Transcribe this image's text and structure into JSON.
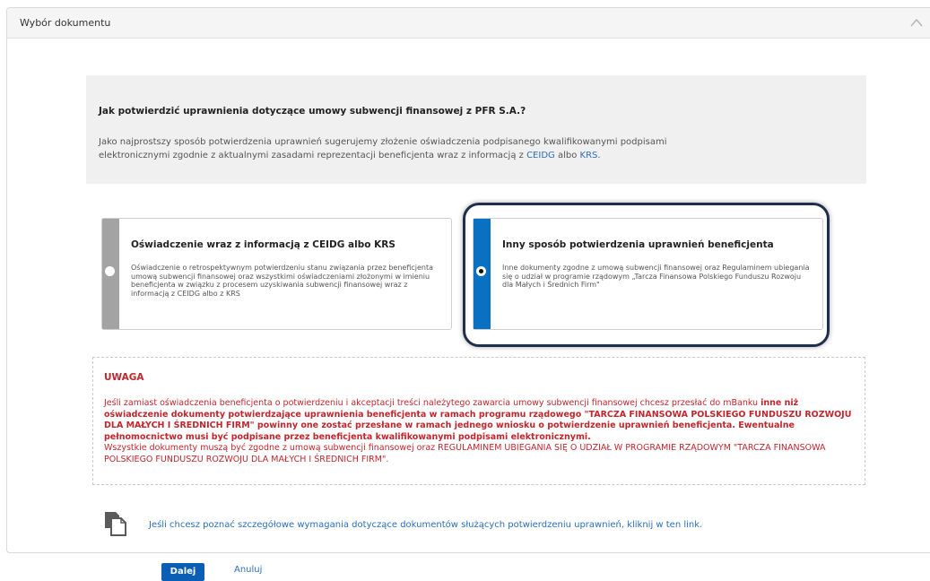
{
  "panel": {
    "title": "Wybór dokumentu",
    "collapse_icon": "chevron-up-icon"
  },
  "info": {
    "title": "Jak potwierdzić uprawnienia dotyczące umowy subwencji finansowej z PFR S.A.?",
    "text_line1": "Jako najprostszy sposób potwierdzenia uprawnień sugerujemy złożenie oświadczenia podpisanego kwalifikowanymi podpisami",
    "text_line2": "elektronicznymi zgodnie z aktualnymi zasadami reprezentacji beneficjenta wraz z informacją z ",
    "link_ceidg": "CEIDG",
    "text_albo": " albo ",
    "link_krs": "KRS",
    "text_end": "."
  },
  "options": [
    {
      "title": "Oświadczenie wraz z informacją z CEIDG albo KRS",
      "text": "Oświadczenie o retrospektywnym potwierdzeniu stanu związania przez beneficjenta umową subwencji finansowej oraz wszystkimi oświadczeniami złożonymi w imieniu beneficjenta w związku z procesem uzyskiwania subwencji finansowej wraz z informacją z CEIDG albo z KRS",
      "selected": false
    },
    {
      "title": "Inny sposób potwierdzenia uprawnień beneficjenta",
      "text": "Inne dokumenty zgodne z umową subwencji finansowej oraz Regulaminem ubiegania się o udział w programie rządowym „Tarcza Finansowa Polskiego Funduszu Rozwoju dla Małych i Średnich Firm\"",
      "selected": true
    }
  ],
  "warning": {
    "title": "UWAGA",
    "p1": "Jeśli zamiast oświadczenia beneficjenta o potwierdzeniu i akceptacji treści należytego zawarcia umowy subwencji finansowej chcesz przesłać do mBanku",
    "p2_bold": "inne niż oświadczenie dokumenty potwierdzające uprawnienia beneficjenta w ramach programu rządowego \"TARCZA FINANSOWA POLSKIEGO FUNDUSZU ROZWOJU DLA MAŁYCH I ŚREDNICH FIRM\" powinny one zostać przesłane w ramach jednego wniosku o potwierdzenie uprawnień beneficjenta. Ewentualne pełnomocnictwo musi być podpisane przez beneficjenta kwalifikowanymi podpisami elektronicznymi.",
    "p3": "Wszystkie dokumenty muszą być zgodne z umową subwencji finansowej oraz REGULAMINEM UBIEGANIA SIĘ O UDZIAŁ W PROGRAMIE RZĄDOWYM \"TARCZA FINANSOWA POLSKIEGO FUNDUSZU ROZWOJU DLA MAŁYCH I ŚREDNICH FIRM\"."
  },
  "doc_link": {
    "icon": "documents-icon",
    "text": "Jeśli chcesz poznać szczegółowe wymagania dotyczące dokumentów służących potwierdzeniu uprawnień, kliknij w ten link."
  },
  "actions": {
    "next": "Dalej",
    "cancel": "Anuluj"
  },
  "colors": {
    "accent": "#0a70c2",
    "warning": "#c0272d",
    "link": "#2a6ebb"
  }
}
